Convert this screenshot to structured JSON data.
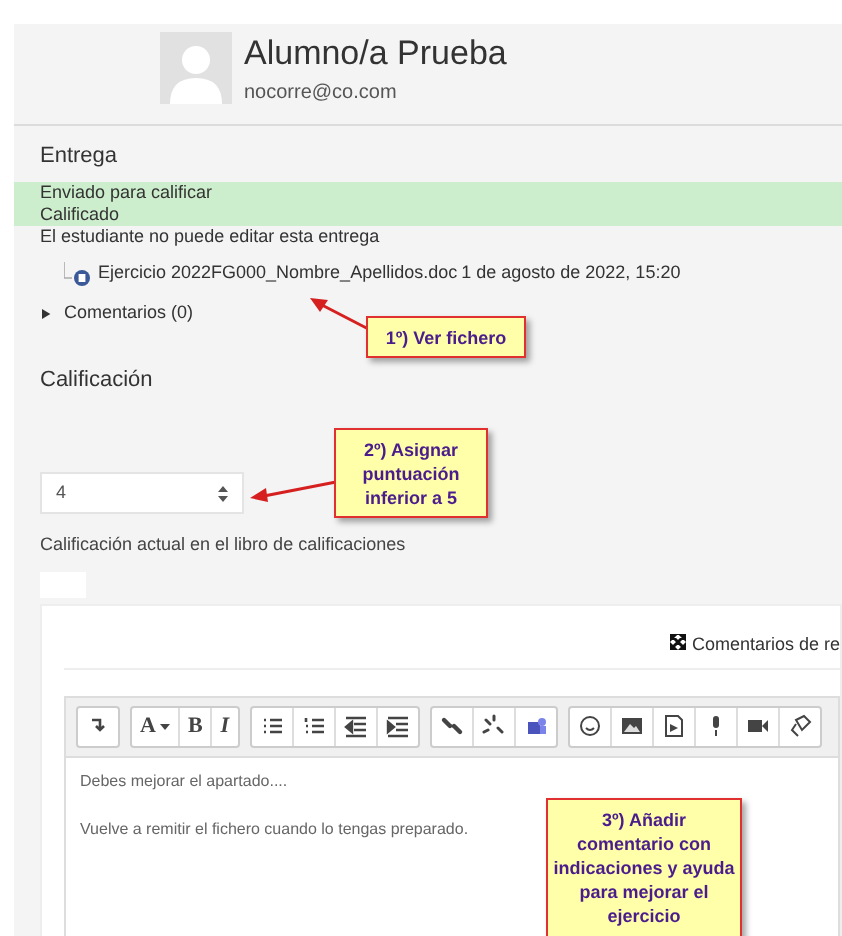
{
  "student": {
    "name": "Alumno/a Prueba",
    "email": "nocorre@co.com"
  },
  "submission": {
    "heading": "Entrega",
    "statuses": [
      {
        "text": "Enviado para calificar",
        "highlighted": true
      },
      {
        "text": "Calificado",
        "highlighted": true
      },
      {
        "text": "El estudiante no puede editar esta entrega",
        "highlighted": false
      }
    ],
    "file": {
      "name": "Ejercicio 2022FG000_Nombre_Apellidos.doc",
      "date": "1 de agosto de 2022, 15:20"
    },
    "comments": {
      "label": "Comentarios (0)",
      "expanded": false
    }
  },
  "grade": {
    "heading": "Calificación",
    "value": "4",
    "current_label": "Calificación actual en el libro de calificaciones"
  },
  "feedback": {
    "title": "Comentarios de re",
    "toolbar": [
      [
        {
          "kind": "collapse"
        }
      ],
      [
        {
          "kind": "glyph",
          "label": "A",
          "caret": true
        },
        {
          "kind": "glyph",
          "label": "B"
        },
        {
          "kind": "glyph",
          "label": "I",
          "italic": true
        }
      ],
      [
        {
          "kind": "list"
        },
        {
          "kind": "numbered"
        },
        {
          "kind": "outdent"
        },
        {
          "kind": "indent"
        }
      ],
      [
        {
          "kind": "link"
        },
        {
          "kind": "unlink"
        },
        {
          "kind": "teams"
        }
      ],
      [
        {
          "kind": "emoji"
        },
        {
          "kind": "image"
        },
        {
          "kind": "media"
        },
        {
          "kind": "mic"
        },
        {
          "kind": "video"
        },
        {
          "kind": "more"
        }
      ]
    ],
    "paragraphs": [
      "Debes mejorar el apartado....",
      "Vuelve a remitir el fichero cuando lo tengas preparado."
    ]
  },
  "callouts": [
    {
      "text": "1º) Ver fichero"
    },
    {
      "text": "2º) Asignar puntuación inferior a 5"
    },
    {
      "text": "3º)  Añadir comentario con indicaciones y ayuda para  mejorar el ejercicio"
    }
  ]
}
